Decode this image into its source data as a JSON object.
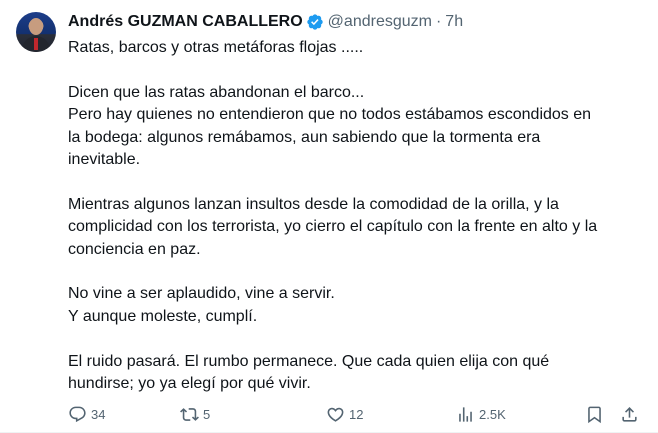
{
  "author": {
    "name": "Andrés GUZMAN CABALLERO",
    "handle": "@andresguzm",
    "separator": "·",
    "time": "7h"
  },
  "body": {
    "lines": [
      "Ratas, barcos y otras metáforas flojas .....",
      "",
      "Dicen que las ratas abandonan el barco...",
      "Pero hay quienes no entendieron que no todos estábamos escondidos en",
      "la bodega: algunos remábamos, aun sabiendo que la tormenta era",
      "inevitable.",
      "",
      "Mientras algunos lanzan insultos desde la comodidad de la orilla, y la",
      "complicidad con los terrorista,  yo cierro el capítulo con la frente en alto y la",
      "conciencia en paz.",
      "",
      "No vine a ser aplaudido, vine a servir.",
      "Y aunque moleste, cumplí.",
      "",
      "El ruido pasará. El rumbo permanece. Que cada quien elija con qué",
      "hundirse; yo ya elegí por qué vivir."
    ]
  },
  "actions": {
    "replies": "34",
    "reposts": "5",
    "likes": "12",
    "views": "2.5K"
  },
  "colors": {
    "text": "#0f1419",
    "muted": "#536471",
    "verified": "#1d9bf0"
  }
}
